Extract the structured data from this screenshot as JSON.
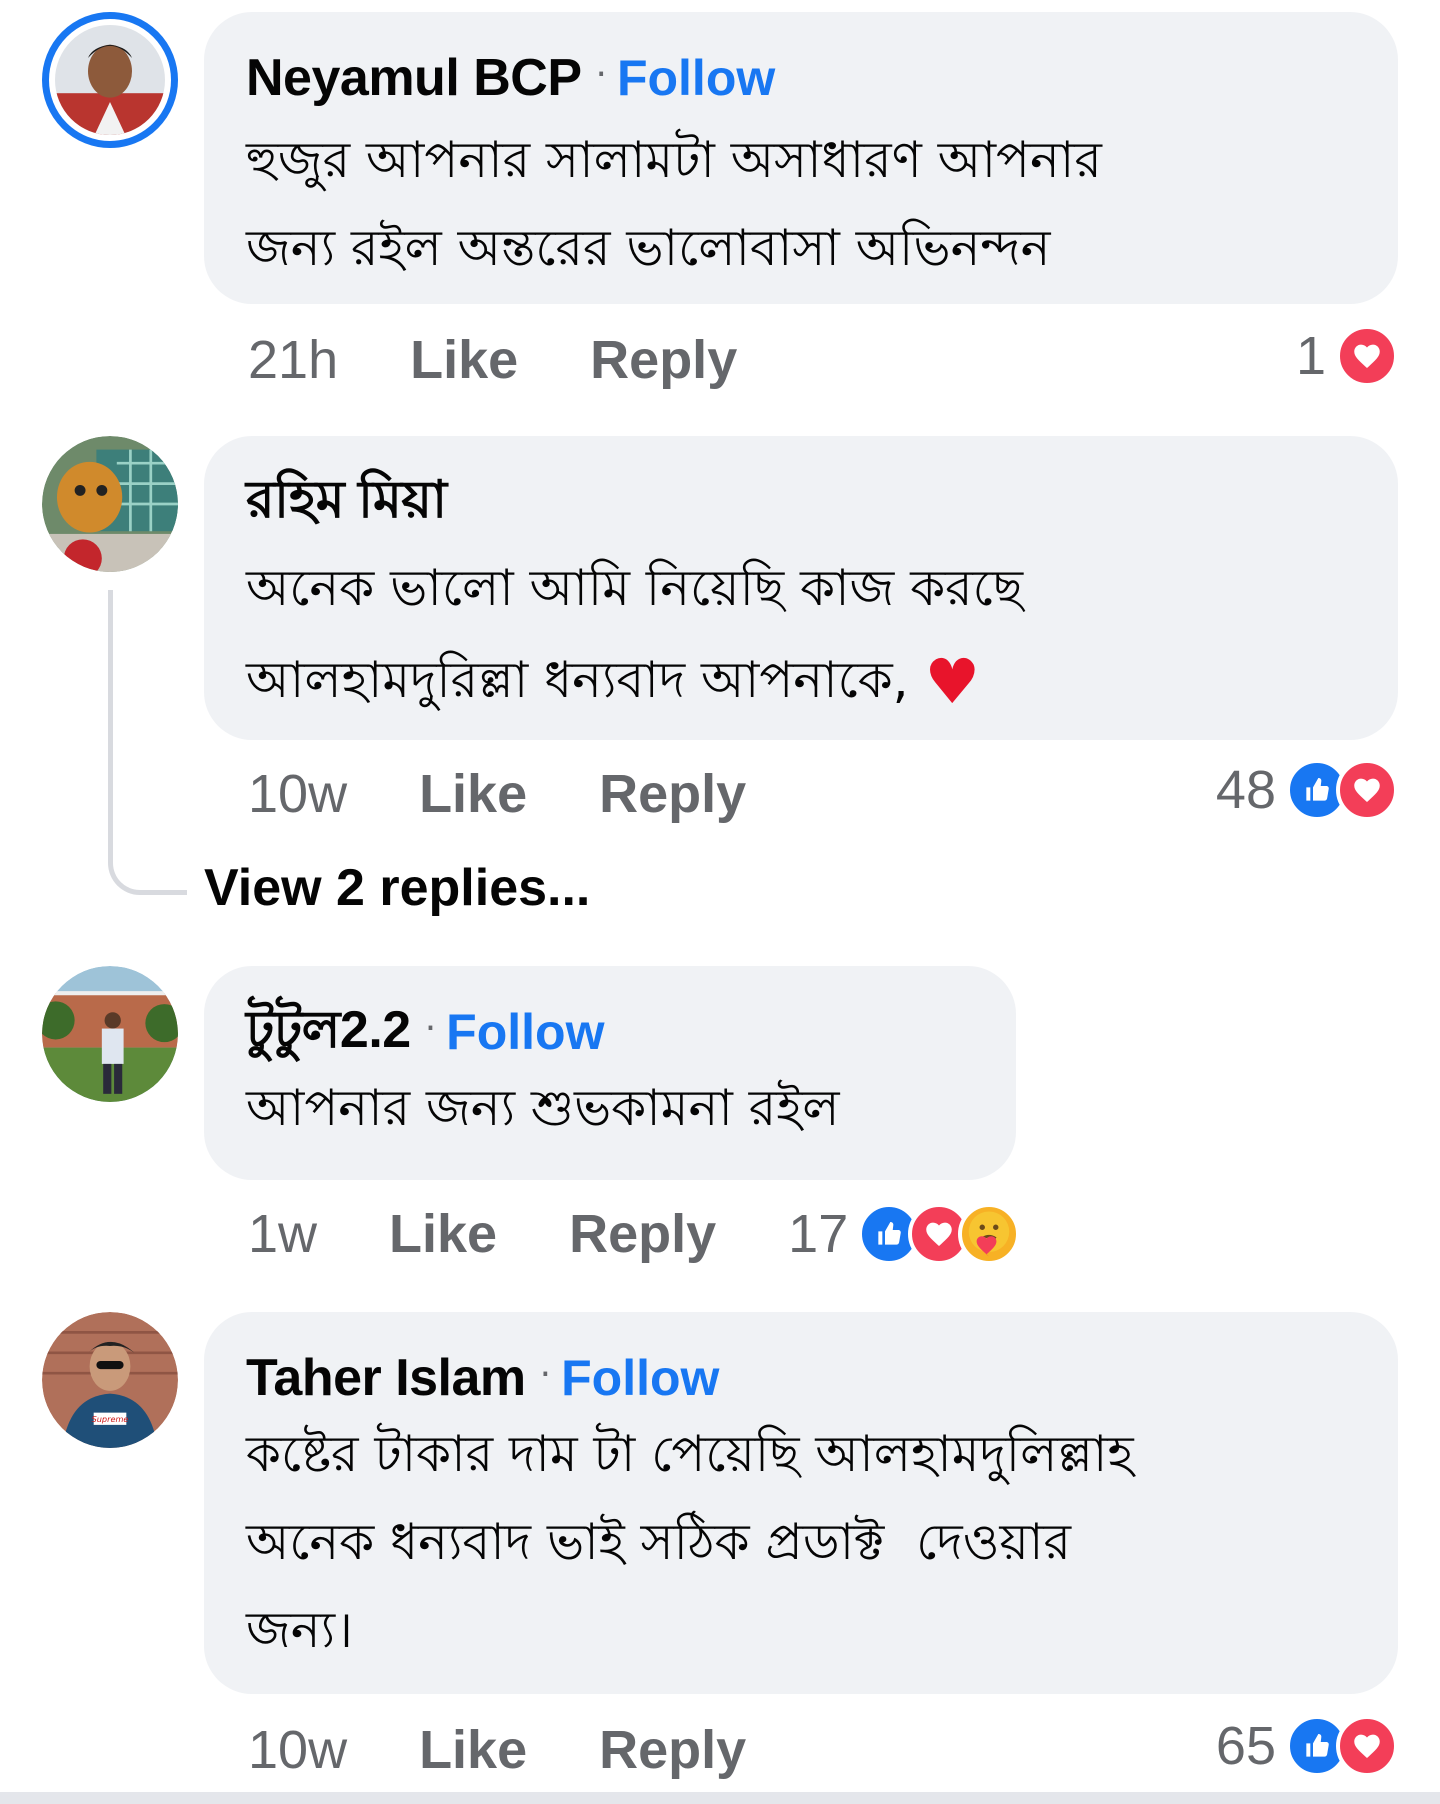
{
  "comments": [
    {
      "author": "Neyamul BCP",
      "follow": "Follow",
      "text": "হুজুর আপনার সালামটা অসাধারণ আপনার\nজন্য রইল অন্তরের ভালোবাসা অভিনন্দন",
      "time": "21h",
      "like": "Like",
      "reply": "Reply",
      "reaction_count": "1",
      "reactions": [
        "heart-reaction"
      ]
    },
    {
      "author": "রহিম মিয়া",
      "text": "অনেক ভালো আমি নিয়েছি কাজ করছে\nআলহামদুরিল্লা ধন্যবাদ আপনাকে,",
      "emoji": "♥",
      "time": "10w",
      "like": "Like",
      "reply": "Reply",
      "reaction_count": "48",
      "reactions": [
        "like-reaction",
        "heart-reaction"
      ],
      "view_replies": "View 2 replies..."
    },
    {
      "author": "টুটুল2.2",
      "follow": "Follow",
      "text": "আপনার জন্য শুভকামনা রইল",
      "time": "1w",
      "like": "Like",
      "reply": "Reply",
      "reaction_count": "17",
      "reactions": [
        "like-reaction",
        "heart-reaction",
        "care-reaction"
      ]
    },
    {
      "author": "Taher Islam",
      "follow": "Follow",
      "text": "কষ্টের টাকার দাম টা পেয়েছি আলহামদুলিল্লাহ\nঅনেক ধন্যবাদ ভাই সঠিক প্রডাক্ট  দেওয়ার\nজন্য।",
      "time": "10w",
      "like": "Like",
      "reply": "Reply",
      "reaction_count": "65",
      "reactions": [
        "like-reaction",
        "heart-reaction"
      ]
    }
  ],
  "colors": {
    "accent": "#1877f2",
    "bubble": "#f0f2f5",
    "secondary_text": "#65676b",
    "love": "#f33e58",
    "emoji_heart": "#e8142b"
  }
}
